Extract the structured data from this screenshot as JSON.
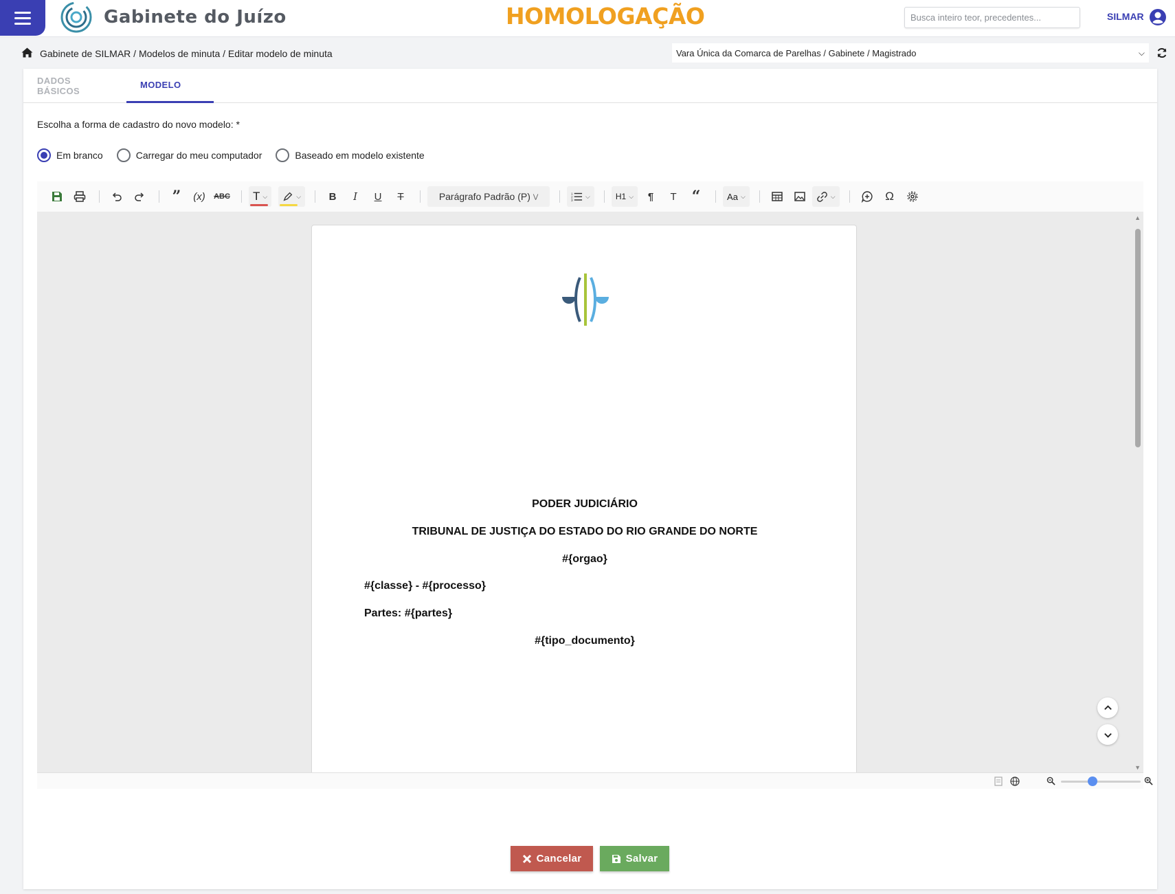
{
  "header": {
    "app_title": "Gabinete do Juízo",
    "environment": "HOMOLOGAÇÃO",
    "search_placeholder": "Busca inteiro teor, precedentes...",
    "user_name": "SILMAR"
  },
  "breadcrumb": {
    "path": "Gabinete de SILMAR / Modelos de minuta / Editar modelo de minuta",
    "org_selected": "Vara Única da Comarca de Parelhas / Gabinete / Magistrado"
  },
  "tabs": [
    {
      "label": "DADOS BÁSICOS",
      "active": false
    },
    {
      "label": "MODELO",
      "active": true
    }
  ],
  "form": {
    "label": "Escolha a forma de cadastro do novo modelo: *",
    "options": [
      {
        "label": "Em branco",
        "checked": true
      },
      {
        "label": "Carregar do meu computador",
        "checked": false
      },
      {
        "label": "Baseado em modelo existente",
        "checked": false
      }
    ]
  },
  "toolbar": {
    "paragraph_style": "Parágrafo Padrão (P)",
    "heading": "H1",
    "case": "Aa",
    "text_color": "#d9534f",
    "highlight_color": "#f5d742",
    "icons": [
      "save-icon",
      "print-icon",
      "undo-icon",
      "redo-icon",
      "quote-icon",
      "variable-icon",
      "spellcheck-icon",
      "text-color-icon",
      "highlight-icon",
      "bold-icon",
      "italic-icon",
      "underline-icon",
      "strikethrough-icon",
      "list-icon",
      "pilcrow-icon",
      "clear-format-icon",
      "blockquote-icon",
      "table-icon",
      "image-icon",
      "link-icon",
      "comment-icon",
      "omega-icon",
      "settings-icon"
    ]
  },
  "document": {
    "line1": "PODER JUDICIÁRIO",
    "line2": "TRIBUNAL DE JUSTIÇA DO ESTADO DO RIO GRANDE DO NORTE",
    "line3": "#{orgao}",
    "line4": "#{classe} - #{processo}",
    "line5": "Partes: #{partes}",
    "line6": "#{tipo_documento}"
  },
  "zoom": {
    "level": 0.4
  },
  "actions": {
    "cancel_label": "Cancelar",
    "save_label": "Salvar"
  },
  "colors": {
    "primary": "#3a3fb3",
    "environment": "#f0a020",
    "cancel": "#c0594f",
    "save": "#6aaa5e"
  }
}
